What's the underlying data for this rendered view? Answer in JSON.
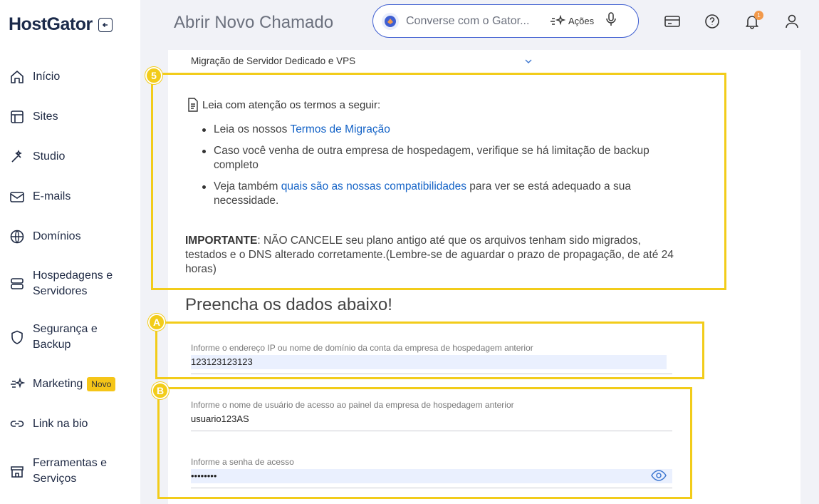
{
  "brand": {
    "logo": "HostGator"
  },
  "sidebar": {
    "items": [
      {
        "label": "Início",
        "icon": "home-icon"
      },
      {
        "label": "Sites",
        "icon": "layout-icon"
      },
      {
        "label": "Studio",
        "icon": "studio-icon"
      },
      {
        "label": "E-mails",
        "icon": "mail-icon"
      },
      {
        "label": "Domínios",
        "icon": "globe-icon"
      },
      {
        "label": "Hospedagens e Servidores",
        "icon": "server-icon"
      },
      {
        "label": "Segurança e Backup",
        "icon": "shield-icon"
      },
      {
        "label": "Marketing",
        "icon": "sparkle-icon",
        "badge": "Novo"
      },
      {
        "label": "Link na bio",
        "icon": "link-icon"
      },
      {
        "label": "Ferramentas e Serviços",
        "icon": "store-icon"
      }
    ]
  },
  "header": {
    "title": "Abrir Novo Chamado",
    "chat_placeholder": "Converse com o Gator...",
    "actions_label": "Ações",
    "notification_count": "1"
  },
  "form": {
    "selected_category": "Migração de Servidor Dedicado e VPS",
    "terms": {
      "heading": "Leia com atenção os termos a seguir:",
      "item1_prefix": "Leia os nossos ",
      "item1_link": "Termos de Migração",
      "item2": "Caso você venha de outra empresa de hospedagem, verifique se há limitação de backup completo",
      "item3_prefix": "Veja também ",
      "item3_link": "quais são as nossas compatibilidades",
      "item3_suffix": " para ver se está adequado a sua necessidade.",
      "important_label": "IMPORTANTE",
      "important_text": ": NÃO CANCELE seu plano antigo até que os arquivos tenham sido migrados, testados e o DNS alterado corretamente.(Lembre-se de aguardar o prazo de propagação, de até 24 horas)"
    },
    "section_title": "Preencha os dados abaixo!",
    "fields": {
      "host": {
        "label": "Informe o endereço IP ou nome de domínio da conta da empresa de hospedagem anterior",
        "value": "123123123123"
      },
      "username": {
        "label": "Informe o nome de usuário de acesso ao painel da empresa de hospedagem anterior",
        "value": "usuario123AS"
      },
      "password": {
        "label": "Informe a senha de acesso",
        "value": "••••••••"
      }
    }
  },
  "annotations": {
    "terms": "5",
    "host": "A",
    "credentials": "B"
  },
  "colors": {
    "highlight": "#f2cc1a",
    "link": "#1463c7",
    "accent": "#3f5fd1"
  }
}
